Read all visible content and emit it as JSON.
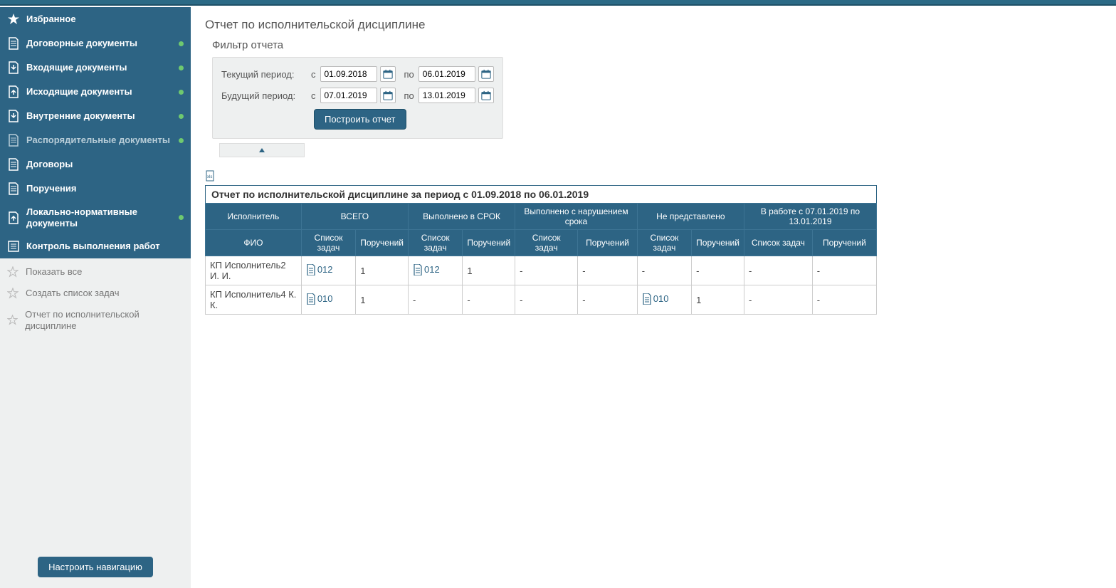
{
  "sidebar": {
    "items": [
      {
        "label": "Избранное",
        "icon": "star",
        "dot": false,
        "muted": false
      },
      {
        "label": "Договорные документы",
        "icon": "doc",
        "dot": true,
        "muted": false
      },
      {
        "label": "Входящие документы",
        "icon": "doc-in",
        "dot": true,
        "muted": false
      },
      {
        "label": "Исходящие документы",
        "icon": "doc-out",
        "dot": true,
        "muted": false
      },
      {
        "label": "Внутренние документы",
        "icon": "doc-in",
        "dot": true,
        "muted": false
      },
      {
        "label": "Распорядительные документы",
        "icon": "doc",
        "dot": true,
        "muted": true
      },
      {
        "label": "Договоры",
        "icon": "doc",
        "dot": false,
        "muted": false
      },
      {
        "label": "Поручения",
        "icon": "doc",
        "dot": false,
        "muted": false
      },
      {
        "label": "Локально-нормативные документы",
        "icon": "doc-out",
        "dot": true,
        "muted": false
      },
      {
        "label": "Контроль выполнения работ",
        "icon": "list",
        "dot": false,
        "muted": false
      }
    ],
    "extras": [
      {
        "label": "Показать все"
      },
      {
        "label": "Создать список задач"
      },
      {
        "label": "Отчет по исполнительской дисциплине"
      }
    ],
    "config_button": "Настроить навигацию"
  },
  "page": {
    "title": "Отчет по исполнительской дисциплине"
  },
  "filter": {
    "title": "Фильтр отчета",
    "current_label": "Текущий период:",
    "future_label": "Будущий период:",
    "from_sep": "с",
    "to_sep": "по",
    "current_from": "01.09.2018",
    "current_to": "06.01.2019",
    "future_from": "07.01.2019",
    "future_to": "13.01.2019",
    "build_button": "Построить отчет"
  },
  "report": {
    "header": "Отчет по исполнительской дисциплине за период с 01.09.2018 по 06.01.2019",
    "groups": [
      {
        "label": "Исполнитель",
        "sub": [
          "ФИО"
        ]
      },
      {
        "label": "ВСЕГО",
        "sub": [
          "Список задач",
          "Поручений"
        ]
      },
      {
        "label": "Выполнено в СРОК",
        "sub": [
          "Список задач",
          "Поручений"
        ]
      },
      {
        "label": "Выполнено с нарушением срока",
        "sub": [
          "Список задач",
          "Поручений"
        ]
      },
      {
        "label": "Не представлено",
        "sub": [
          "Список задач",
          "Поручений"
        ]
      },
      {
        "label": "В работе с 07.01.2019 по 13.01.2019",
        "sub": [
          "Список задач",
          "Поручений"
        ]
      }
    ],
    "rows": [
      {
        "fio": "КП Исполнитель2 И. И.",
        "cells": [
          {
            "link": "012"
          },
          "1",
          {
            "link": "012"
          },
          "1",
          "-",
          "-",
          "-",
          "-",
          "-",
          "-"
        ]
      },
      {
        "fio": "КП Исполнитель4 К. К.",
        "cells": [
          {
            "link": "010"
          },
          "1",
          "-",
          "-",
          "-",
          "-",
          {
            "link": "010"
          },
          "1",
          "-",
          "-"
        ]
      }
    ]
  }
}
